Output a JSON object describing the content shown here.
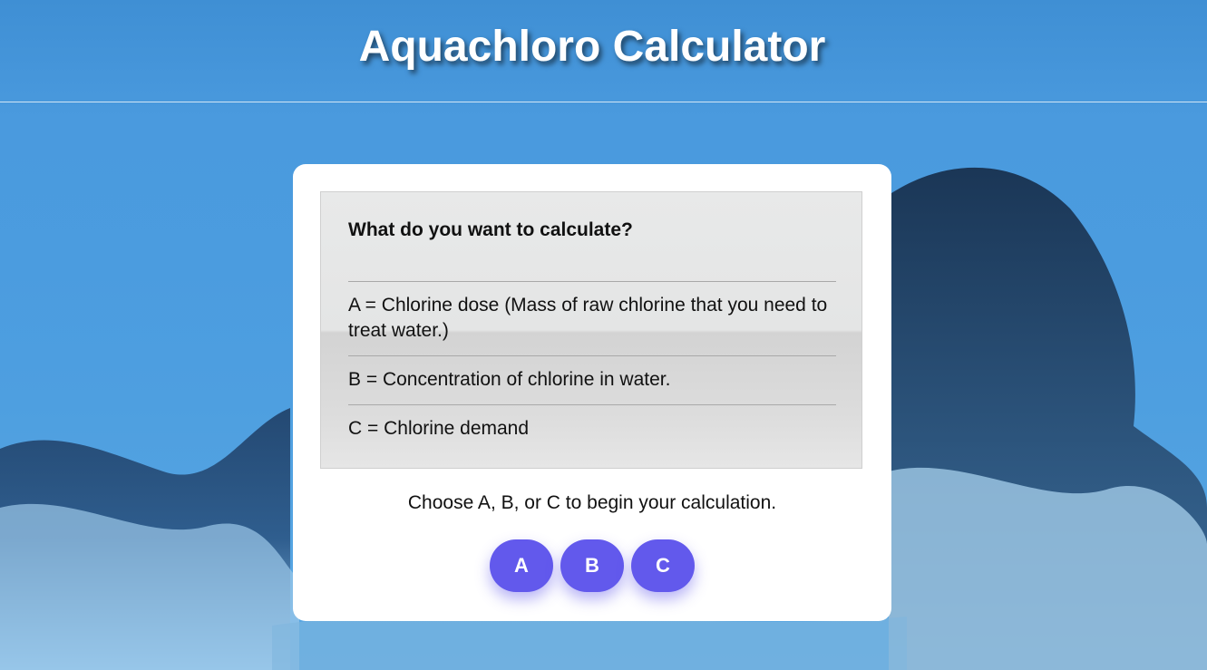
{
  "header": {
    "title": "Aquachloro Calculator"
  },
  "panel": {
    "question": "What do you want to calculate?",
    "options": [
      {
        "label": "A = Chlorine dose (Mass of raw chlorine that you need to treat water.)"
      },
      {
        "label": "B = Concentration of chlorine in water."
      },
      {
        "label": "C = Chlorine demand"
      }
    ]
  },
  "prompt": "Choose A, B, or C to begin your calculation.",
  "buttons": [
    {
      "label": "A"
    },
    {
      "label": "B"
    },
    {
      "label": "C"
    }
  ],
  "colors": {
    "accent": "#6259ec",
    "background": "#4b9cdf",
    "card": "#ffffff"
  }
}
